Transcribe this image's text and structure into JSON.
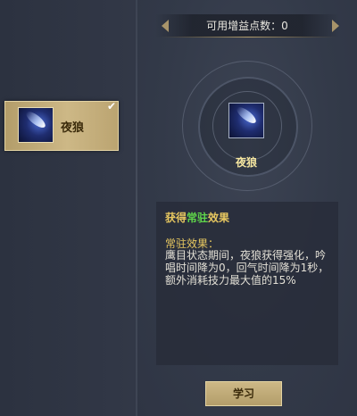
{
  "points": {
    "label": "可用增益点数：0"
  },
  "skill_list": [
    {
      "name": "夜狼",
      "selected": true,
      "learned_icon": "check-mark-icon",
      "icon": "comet-icon"
    }
  ],
  "detail": {
    "icon": "comet-icon",
    "name": "夜狼",
    "title_prefix": "获得",
    "title_highlight": "常驻",
    "title_suffix": "效果",
    "sub_title": "常驻效果：",
    "body": "鹰目状态期间，夜狼获得强化，吟唱时间降为0，回气时间降为1秒，额外消耗技力最大值的15%"
  },
  "learn_button": {
    "label": "学习"
  },
  "colors": {
    "gold": "#cdb886",
    "highlight_green": "#5fd64a",
    "title_yellow": "#e8c860"
  }
}
